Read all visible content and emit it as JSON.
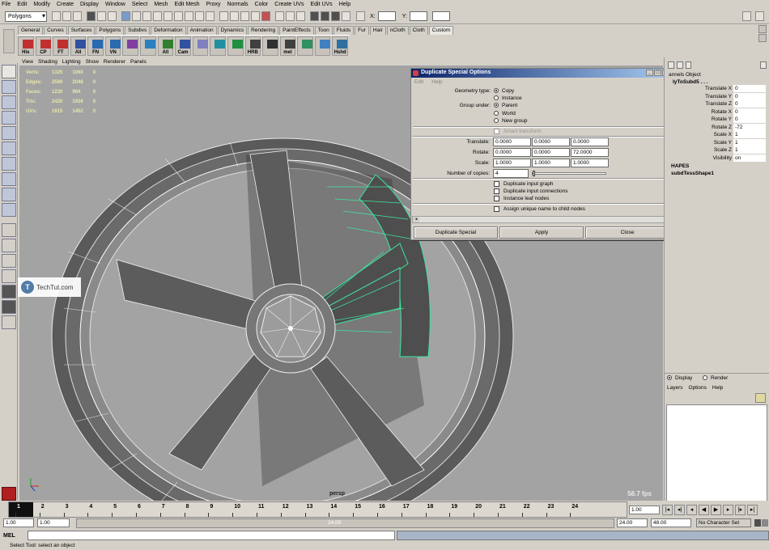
{
  "menu": [
    "File",
    "Edit",
    "Modify",
    "Create",
    "Display",
    "Window",
    "Select",
    "Mesh",
    "Edit Mesh",
    "Proxy",
    "Normals",
    "Color",
    "Create UVs",
    "Edit UVs",
    "Help"
  ],
  "status": {
    "mode": "Polygons",
    "x_label": "X:",
    "y_label": "Y:",
    "z_label": ""
  },
  "shelf_tabs": [
    "General",
    "Curves",
    "Surfaces",
    "Polygons",
    "Subdivs",
    "Deformation",
    "Animation",
    "Dynamics",
    "Rendering",
    "PaintEffects",
    "Toon",
    "Fluids",
    "Fur",
    "Hair",
    "nCloth",
    "Cloth",
    "Custom"
  ],
  "shelf_icons": [
    "His",
    "CP",
    "FT",
    "All",
    "FN",
    "VN",
    "",
    "",
    "All",
    "Cam",
    "",
    "",
    "",
    "HRB",
    "",
    "mel",
    "",
    "",
    "Hshd"
  ],
  "viewport": {
    "menu": [
      "View",
      "Shading",
      "Lighting",
      "Show",
      "Renderer",
      "Panels"
    ],
    "hud": [
      {
        "label": "Verts:",
        "a": "1325",
        "b": "1060",
        "c": "0"
      },
      {
        "label": "Edges:",
        "a": "2560",
        "b": "2048",
        "c": "0"
      },
      {
        "label": "Faces:",
        "a": "1230",
        "b": "984",
        "c": "0"
      },
      {
        "label": "Tris:",
        "a": "2420",
        "b": "1936",
        "c": "0"
      },
      {
        "label": "UVs:",
        "a": "1815",
        "b": "1452",
        "c": "0"
      }
    ],
    "fps": "58.7 fps",
    "camera": "persp",
    "watermark": "TechTut.com",
    "watermark_logo": "T"
  },
  "dialog": {
    "title": "Duplicate Special Options",
    "menu": [
      "Edit",
      "Help"
    ],
    "geometry_type_label": "Geometry type:",
    "geometry_types": [
      "Copy",
      "Instance"
    ],
    "group_under_label": "Group under:",
    "group_under": [
      "Parent",
      "World",
      "New group"
    ],
    "smart_transform": "Smart transform",
    "translate_label": "Translate:",
    "translate": [
      "0.0000",
      "0.0000",
      "0.0000"
    ],
    "rotate_label": "Rotate:",
    "rotate": [
      "0.0000",
      "0.0000",
      "72.0000"
    ],
    "scale_label": "Scale:",
    "scale": [
      "1.0000",
      "1.0000",
      "1.0000"
    ],
    "copies_label": "Number of copies:",
    "copies": "4",
    "options": [
      "Duplicate input graph",
      "Duplicate input connections",
      "Instance leaf nodes"
    ],
    "assign_unique": "Assign unique name to child nodes",
    "buttons": [
      "Duplicate Special",
      "Apply",
      "Close"
    ]
  },
  "channel_box": {
    "tabs": "annels  Object",
    "object": "lyToSubd5 . . .",
    "attrs": [
      {
        "n": "Translate X",
        "v": "0"
      },
      {
        "n": "Translate Y",
        "v": "0"
      },
      {
        "n": "Translate Z",
        "v": "0"
      },
      {
        "n": "Rotate X",
        "v": "0"
      },
      {
        "n": "Rotate Y",
        "v": "0"
      },
      {
        "n": "Rotate Z",
        "v": "-72"
      },
      {
        "n": "Scale X",
        "v": "1"
      },
      {
        "n": "Scale Y",
        "v": "1"
      },
      {
        "n": "Scale Z",
        "v": "1"
      },
      {
        "n": "Visibility",
        "v": "on"
      }
    ],
    "shapes_label": "HAPES",
    "shape_name": "subdTessShape1"
  },
  "layers": {
    "display": "Display",
    "render": "Render",
    "menu": [
      "Layers",
      "Options",
      "Help"
    ]
  },
  "timeline": {
    "ticks": [
      "1",
      "2",
      "3",
      "4",
      "5",
      "6",
      "7",
      "8",
      "9",
      "10",
      "11",
      "12",
      "13",
      "14",
      "15",
      "16",
      "17",
      "18",
      "19",
      "20",
      "21",
      "22",
      "23",
      "24"
    ],
    "current": "1.00",
    "range_start": "1.00",
    "range_start2": "1.00",
    "range_mid": "24.00",
    "range_end": "24.00",
    "range_end2": "48.00",
    "character_set": "No Character Set"
  },
  "cmd": {
    "label": "MEL"
  },
  "help_line": "Select Tool: select an object"
}
